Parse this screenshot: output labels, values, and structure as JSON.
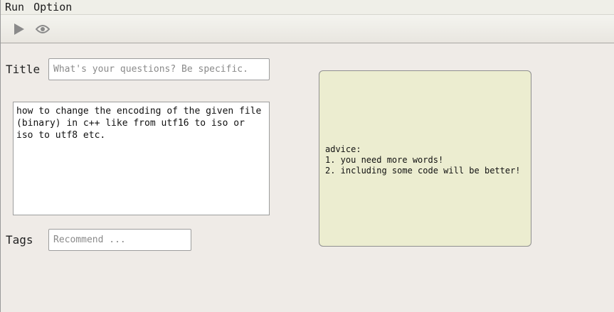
{
  "menubar": {
    "items": [
      {
        "label": "Run"
      },
      {
        "label": "Option"
      }
    ]
  },
  "toolbar": {
    "run_icon": "play-icon",
    "preview_icon": "eye-icon"
  },
  "form": {
    "title_label": "Title",
    "title_placeholder": "What's your questions? Be specific.",
    "title_value": "",
    "body_value": "how to change the encoding of the given file (binary) in c++ like from utf16 to iso or iso to utf8 etc.",
    "tags_label": "Tags",
    "tags_placeholder": "Recommend ...",
    "tags_value": ""
  },
  "advice": {
    "heading": "advice:",
    "items": [
      "1. you need more words!",
      "2. including some code will be better!"
    ]
  },
  "colors": {
    "window_bg": "#efebe7",
    "advice_bg": "#ecedd0",
    "icon_gray": "#8a8a8a"
  }
}
